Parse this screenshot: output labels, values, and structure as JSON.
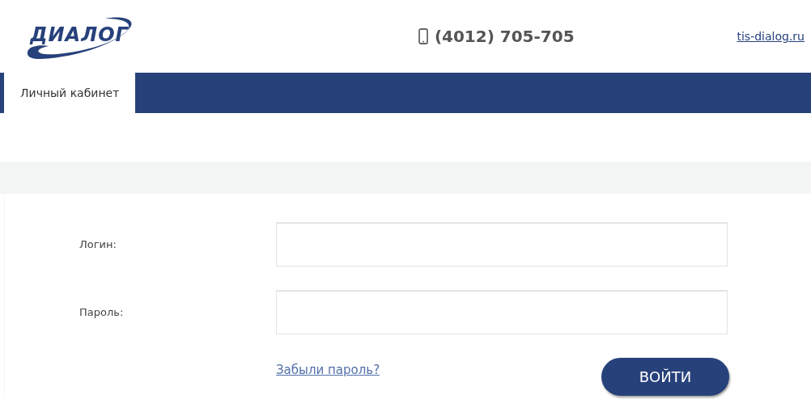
{
  "header": {
    "logo": "ДИАЛОГ",
    "phone": "(4012) 705-705",
    "site_link": "tis-dialog.ru"
  },
  "tabs": [
    {
      "label": "Личный кабинет",
      "selected": true
    }
  ],
  "form": {
    "fields": [
      {
        "label": "Логин:"
      },
      {
        "label": "Пароль:"
      }
    ],
    "forgot_link": "Забыли пароль?",
    "submit": "ВОЙТИ"
  }
}
